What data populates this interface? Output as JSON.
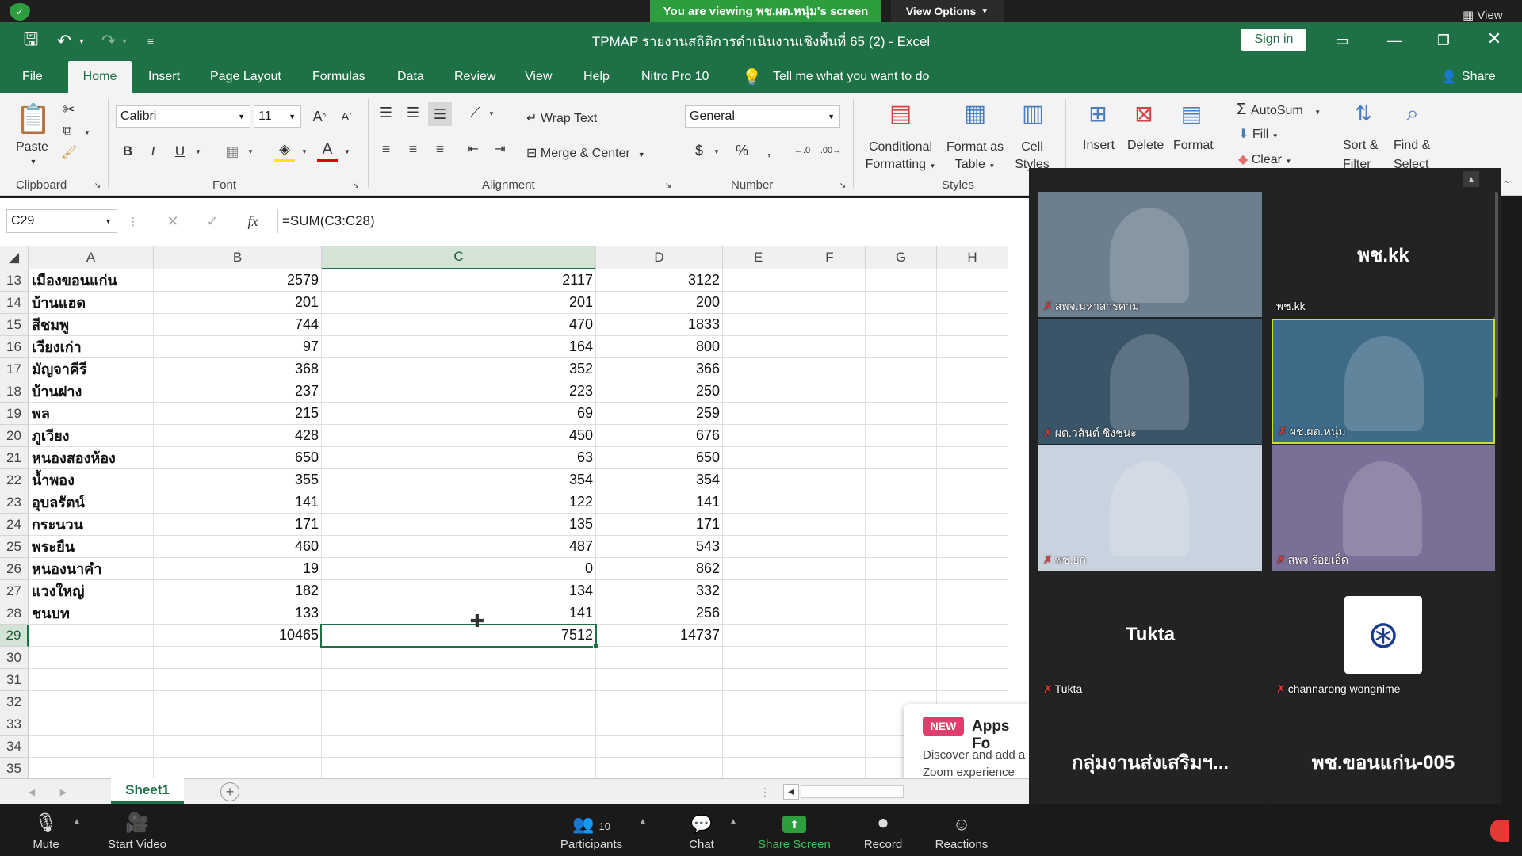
{
  "zoom": {
    "viewing_banner": "You are viewing พช.ผต.หนุ่ม's screen",
    "view_options": "View Options",
    "view": "View",
    "bottom": {
      "mute": "Mute",
      "start_video": "Start Video",
      "participants": "Participants",
      "participants_count": "10",
      "chat": "Chat",
      "share_screen": "Share Screen",
      "record": "Record",
      "reactions": "Reactions"
    },
    "tiles": [
      {
        "name": "สพจ.มหาสารคาม",
        "big": ""
      },
      {
        "name": "พช.kk",
        "big": "พช.kk"
      },
      {
        "name": "ผต.วสันต์ ชิงชนะ",
        "big": ""
      },
      {
        "name": "ผช.ผต.หนุ่ม",
        "big": ""
      },
      {
        "name": "พช.ยก",
        "big": ""
      },
      {
        "name": "สพจ.ร้อยเอ็ด",
        "big": ""
      },
      {
        "name": "Tukta",
        "big": "Tukta"
      },
      {
        "name": "channarong wongnime",
        "big": ""
      },
      {
        "name": "กลุ่มงานส่งเสริมฯ-ขอนแก่น",
        "big": "กลุ่มงานส่งเสริมฯ..."
      },
      {
        "name": "พช.ขอนแก่น-005",
        "big": "พช.ขอนแก่น-005"
      }
    ],
    "apps_popup": {
      "badge": "NEW",
      "title": "Apps Fo",
      "text1": "Discover and add a",
      "text2": "Zoom experience"
    }
  },
  "excel": {
    "title": "TPMAP รายงานสถิติการดำเนินงานเชิงพื้นที่ 65 (2)  -  Excel",
    "sign_in": "Sign in",
    "share": "Share",
    "tabs": [
      "File",
      "Home",
      "Insert",
      "Page Layout",
      "Formulas",
      "Data",
      "Review",
      "View",
      "Help",
      "Nitro Pro 10"
    ],
    "tell_me": "Tell me what you want to do",
    "ribbon": {
      "paste": "Paste",
      "clipboard": "Clipboard",
      "font_name": "Calibri",
      "font_size": "11",
      "font": "Font",
      "wrap_text": "Wrap Text",
      "merge_center": "Merge & Center",
      "alignment": "Alignment",
      "number_format": "General",
      "number": "Number",
      "conditional": "Conditional",
      "formatting": "Formatting",
      "format_as": "Format as",
      "table": "Table",
      "cell": "Cell",
      "styles_btn": "Styles",
      "styles": "Styles",
      "insert": "Insert",
      "delete": "Delete",
      "format": "Format",
      "autosum": "AutoSum",
      "fill": "Fill",
      "clear": "Clear",
      "sort": "Sort &",
      "filter": "Filter",
      "find": "Find &",
      "select": "Select"
    },
    "name_box": "C29",
    "formula": "=SUM(C3:C28)",
    "columns": [
      "A",
      "B",
      "C",
      "D",
      "E",
      "F",
      "G",
      "H"
    ],
    "rows": [
      {
        "n": "13",
        "a": "เมืองขอนแก่น",
        "b": "2579",
        "c": "2117",
        "d": "3122"
      },
      {
        "n": "14",
        "a": "บ้านแฮด",
        "b": "201",
        "c": "201",
        "d": "200"
      },
      {
        "n": "15",
        "a": "สีชมพู",
        "b": "744",
        "c": "470",
        "d": "1833"
      },
      {
        "n": "16",
        "a": "เวียงเก่า",
        "b": "97",
        "c": "164",
        "d": "800"
      },
      {
        "n": "17",
        "a": "มัญจาคีรี",
        "b": "368",
        "c": "352",
        "d": "366"
      },
      {
        "n": "18",
        "a": "บ้านฝาง",
        "b": "237",
        "c": "223",
        "d": "250"
      },
      {
        "n": "19",
        "a": "พล",
        "b": "215",
        "c": "69",
        "d": "259"
      },
      {
        "n": "20",
        "a": "ภูเวียง",
        "b": "428",
        "c": "450",
        "d": "676"
      },
      {
        "n": "21",
        "a": "หนองสองห้อง",
        "b": "650",
        "c": "63",
        "d": "650"
      },
      {
        "n": "22",
        "a": "น้ำพอง",
        "b": "355",
        "c": "354",
        "d": "354"
      },
      {
        "n": "23",
        "a": "อุบลรัตน์",
        "b": "141",
        "c": "122",
        "d": "141"
      },
      {
        "n": "24",
        "a": "กระนวน",
        "b": "171",
        "c": "135",
        "d": "171"
      },
      {
        "n": "25",
        "a": "พระยืน",
        "b": "460",
        "c": "487",
        "d": "543"
      },
      {
        "n": "26",
        "a": "หนองนาคำ",
        "b": "19",
        "c": "0",
        "d": "862"
      },
      {
        "n": "27",
        "a": "แวงใหญ่",
        "b": "182",
        "c": "134",
        "d": "332"
      },
      {
        "n": "28",
        "a": "ชนบท",
        "b": "133",
        "c": "141",
        "d": "256"
      },
      {
        "n": "29",
        "a": "",
        "b": "10465",
        "c": "7512",
        "d": "14737"
      },
      {
        "n": "30",
        "a": "",
        "b": "",
        "c": "",
        "d": ""
      },
      {
        "n": "31",
        "a": "",
        "b": "",
        "c": "",
        "d": ""
      },
      {
        "n": "32",
        "a": "",
        "b": "",
        "c": "",
        "d": ""
      },
      {
        "n": "33",
        "a": "",
        "b": "",
        "c": "",
        "d": ""
      },
      {
        "n": "34",
        "a": "",
        "b": "",
        "c": "",
        "d": ""
      },
      {
        "n": "35",
        "a": "",
        "b": "",
        "c": "",
        "d": ""
      }
    ],
    "sheet": "Sheet1"
  }
}
